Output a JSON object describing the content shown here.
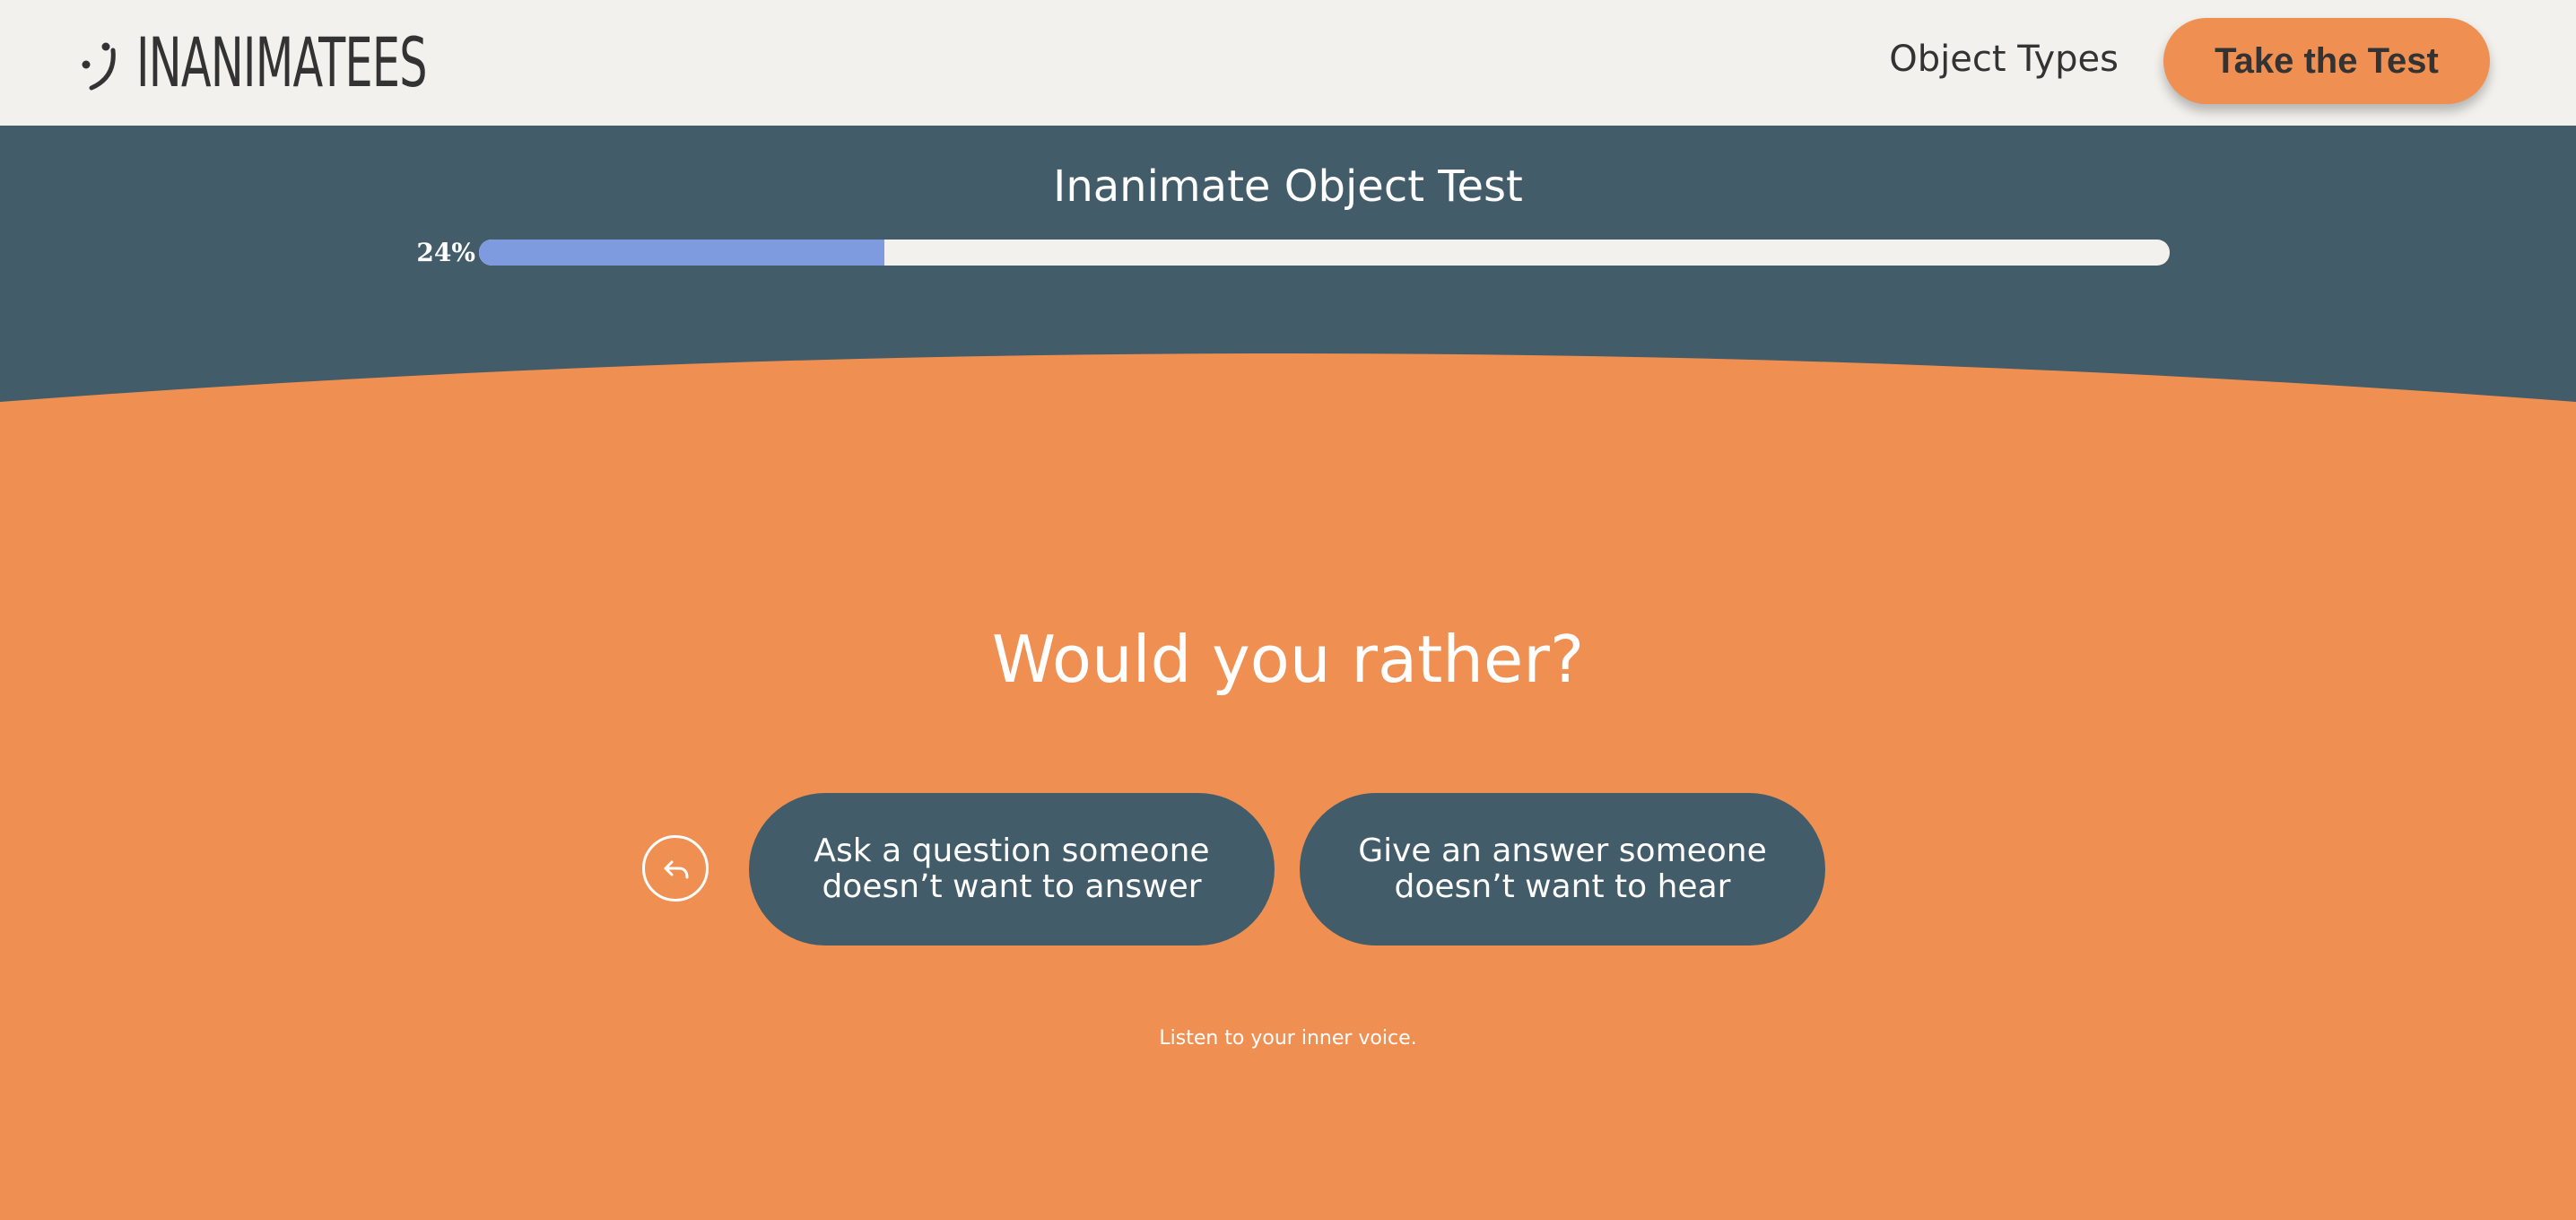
{
  "header": {
    "logo_text": "INANIMATEES",
    "nav": {
      "object_types_label": "Object Types"
    },
    "cta_label": "Take the Test"
  },
  "test": {
    "title": "Inanimate Object Test",
    "progress_label": "24%",
    "progress_fraction": 0.24
  },
  "question": {
    "prompt": "Would you rather?",
    "answers": [
      {
        "label": "Ask a question someone doesn’t want to answer"
      },
      {
        "label": "Give an answer someone doesn’t want to hear"
      }
    ],
    "back_icon": "undo-arrow-icon",
    "hint": "Listen to your inner voice."
  },
  "colors": {
    "header_bg": "#f2f1ed",
    "band_bg": "#425c6a",
    "accent_orange": "#ef9052",
    "progress_fill": "#7f9be0",
    "progress_track": "#f2f1ed",
    "text_dark": "#333333"
  }
}
